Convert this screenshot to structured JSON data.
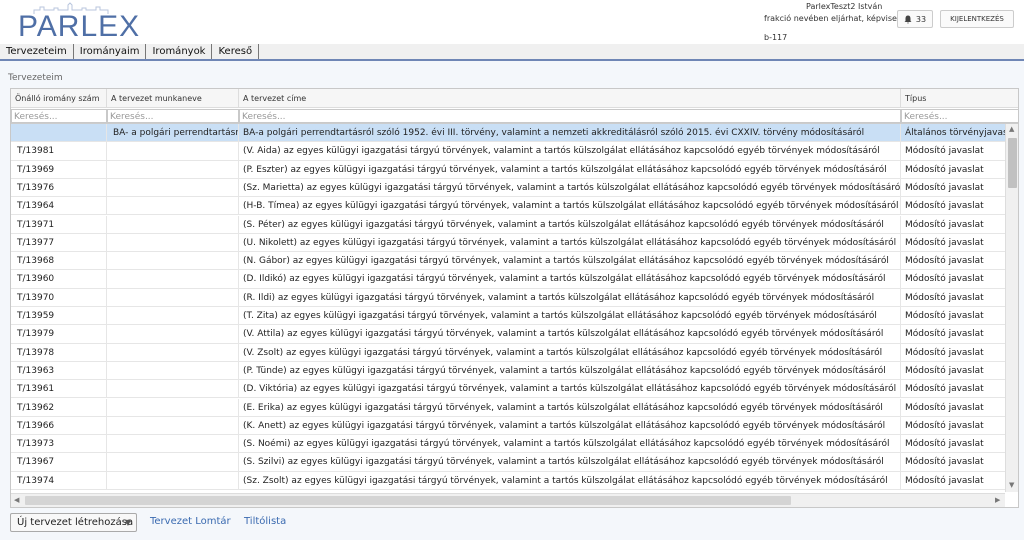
{
  "app": {
    "logo_text": "PARLEX",
    "user_name": "ParlexTeszt2 István",
    "user_role": "frakció nevében eljárhat, képviselő",
    "session_id": "b-117",
    "notification_count": "33",
    "logout_label": "KIJELENTKEZÉS"
  },
  "menu": [
    "Tervezeteim",
    "Irományaim",
    "Irományok",
    "Kereső"
  ],
  "section_title": "Tervezeteim",
  "table": {
    "columns": [
      "Önálló iromány szám",
      "A tervezet munkaneve",
      "A tervezet címe",
      "Típus"
    ],
    "filter_placeholder": "Keresés...",
    "selected_row": {
      "num": "",
      "name": "BA- a polgári perrendtartásról",
      "title": "BA-a polgári perrendtartásról szóló 1952. évi III. törvény, valamint a nemzeti akkreditálásról szóló 2015. évi CXXIV. törvény módosításáról",
      "type": "Általános törvényjavaslat"
    },
    "rows": [
      {
        "num": "T/13981",
        "title": "(V. Aida) az egyes külügyi igazgatási tárgyú törvények, valamint a tartós külszolgálat ellátásához kapcsolódó egyéb törvények módosításáról",
        "type": "Módosító javaslat"
      },
      {
        "num": "T/13969",
        "title": "(P. Eszter) az egyes külügyi igazgatási tárgyú törvények, valamint a tartós külszolgálat ellátásához kapcsolódó egyéb törvények módosításáról",
        "type": "Módosító javaslat"
      },
      {
        "num": "T/13976",
        "title": "(Sz. Marietta) az egyes külügyi igazgatási tárgyú törvények, valamint a tartós külszolgálat ellátásához kapcsolódó egyéb törvények módosításáról",
        "type": "Módosító javaslat"
      },
      {
        "num": "T/13964",
        "title": "(H-B. Tímea) az egyes külügyi igazgatási tárgyú törvények, valamint a tartós külszolgálat ellátásához kapcsolódó egyéb törvények módosításáról",
        "type": "Módosító javaslat"
      },
      {
        "num": "T/13971",
        "title": "(S. Péter) az egyes külügyi igazgatási tárgyú törvények, valamint a tartós külszolgálat ellátásához kapcsolódó egyéb törvények módosításáról",
        "type": "Módosító javaslat"
      },
      {
        "num": "T/13977",
        "title": "(U. Nikolett) az egyes külügyi igazgatási tárgyú törvények, valamint a tartós külszolgálat ellátásához kapcsolódó egyéb törvények módosításáról",
        "type": "Módosító javaslat"
      },
      {
        "num": "T/13968",
        "title": "(N. Gábor) az egyes külügyi igazgatási tárgyú törvények, valamint a tartós külszolgálat ellátásához kapcsolódó egyéb törvények módosításáról",
        "type": "Módosító javaslat"
      },
      {
        "num": "T/13960",
        "title": "(D. Ildikó) az egyes külügyi igazgatási tárgyú törvények, valamint a tartós külszolgálat ellátásához kapcsolódó egyéb törvények módosításáról",
        "type": "Módosító javaslat"
      },
      {
        "num": "T/13970",
        "title": "(R. Ildi) az egyes külügyi igazgatási tárgyú törvények, valamint a tartós külszolgálat ellátásához kapcsolódó egyéb törvények módosításáról",
        "type": "Módosító javaslat"
      },
      {
        "num": "T/13959",
        "title": "(T. Zita) az egyes külügyi igazgatási tárgyú törvények, valamint a tartós külszolgálat ellátásához kapcsolódó egyéb törvények módosításáról",
        "type": "Módosító javaslat"
      },
      {
        "num": "T/13979",
        "title": "(V. Attila) az egyes külügyi igazgatási tárgyú törvények, valamint a tartós külszolgálat ellátásához kapcsolódó egyéb törvények módosításáról",
        "type": "Módosító javaslat"
      },
      {
        "num": "T/13978",
        "title": "(V. Zsolt) az egyes külügyi igazgatási tárgyú törvények, valamint a tartós külszolgálat ellátásához kapcsolódó egyéb törvények módosításáról",
        "type": "Módosító javaslat"
      },
      {
        "num": "T/13963",
        "title": "(P. Tünde) az egyes külügyi igazgatási tárgyú törvények, valamint a tartós külszolgálat ellátásához kapcsolódó egyéb törvények módosításáról",
        "type": "Módosító javaslat"
      },
      {
        "num": "T/13961",
        "title": "(D. Viktória) az egyes külügyi igazgatási tárgyú törvények, valamint a tartós külszolgálat ellátásához kapcsolódó egyéb törvények módosításáról",
        "type": "Módosító javaslat"
      },
      {
        "num": "T/13962",
        "title": "(E. Erika) az egyes külügyi igazgatási tárgyú törvények, valamint a tartós külszolgálat ellátásához kapcsolódó egyéb törvények módosításáról",
        "type": "Módosító javaslat"
      },
      {
        "num": "T/13966",
        "title": "(K. Anett) az egyes külügyi igazgatási tárgyú törvények, valamint a tartós külszolgálat ellátásához kapcsolódó egyéb törvények módosításáról",
        "type": "Módosító javaslat"
      },
      {
        "num": "T/13973",
        "title": "(S. Noémi) az egyes külügyi igazgatási tárgyú törvények, valamint a tartós külszolgálat ellátásához kapcsolódó egyéb törvények módosításáról",
        "type": "Módosító javaslat"
      },
      {
        "num": "T/13967",
        "title": "(S. Szilvi) az egyes külügyi igazgatási tárgyú törvények, valamint a tartós külszolgálat ellátásához kapcsolódó egyéb törvények módosításáról",
        "type": "Módosító javaslat"
      },
      {
        "num": "T/13974",
        "title": "(Sz. Zsolt) az egyes külügyi igazgatási tárgyú törvények, valamint a tartós külszolgálat ellátásához kapcsolódó egyéb törvények módosításáról",
        "type": "Módosító javaslat"
      }
    ]
  },
  "footer": {
    "create_label": "Új tervezet létrehozása",
    "archive_label": "Tervezet Lomtár",
    "blacklist_label": "Tiltólista"
  },
  "icons": {
    "notification": "bell-icon",
    "dropdown": "caret-down-icon"
  },
  "colors": {
    "accent": "#4f6fa6",
    "selected_row": "#c9dff5",
    "link": "#3a6ab0"
  }
}
